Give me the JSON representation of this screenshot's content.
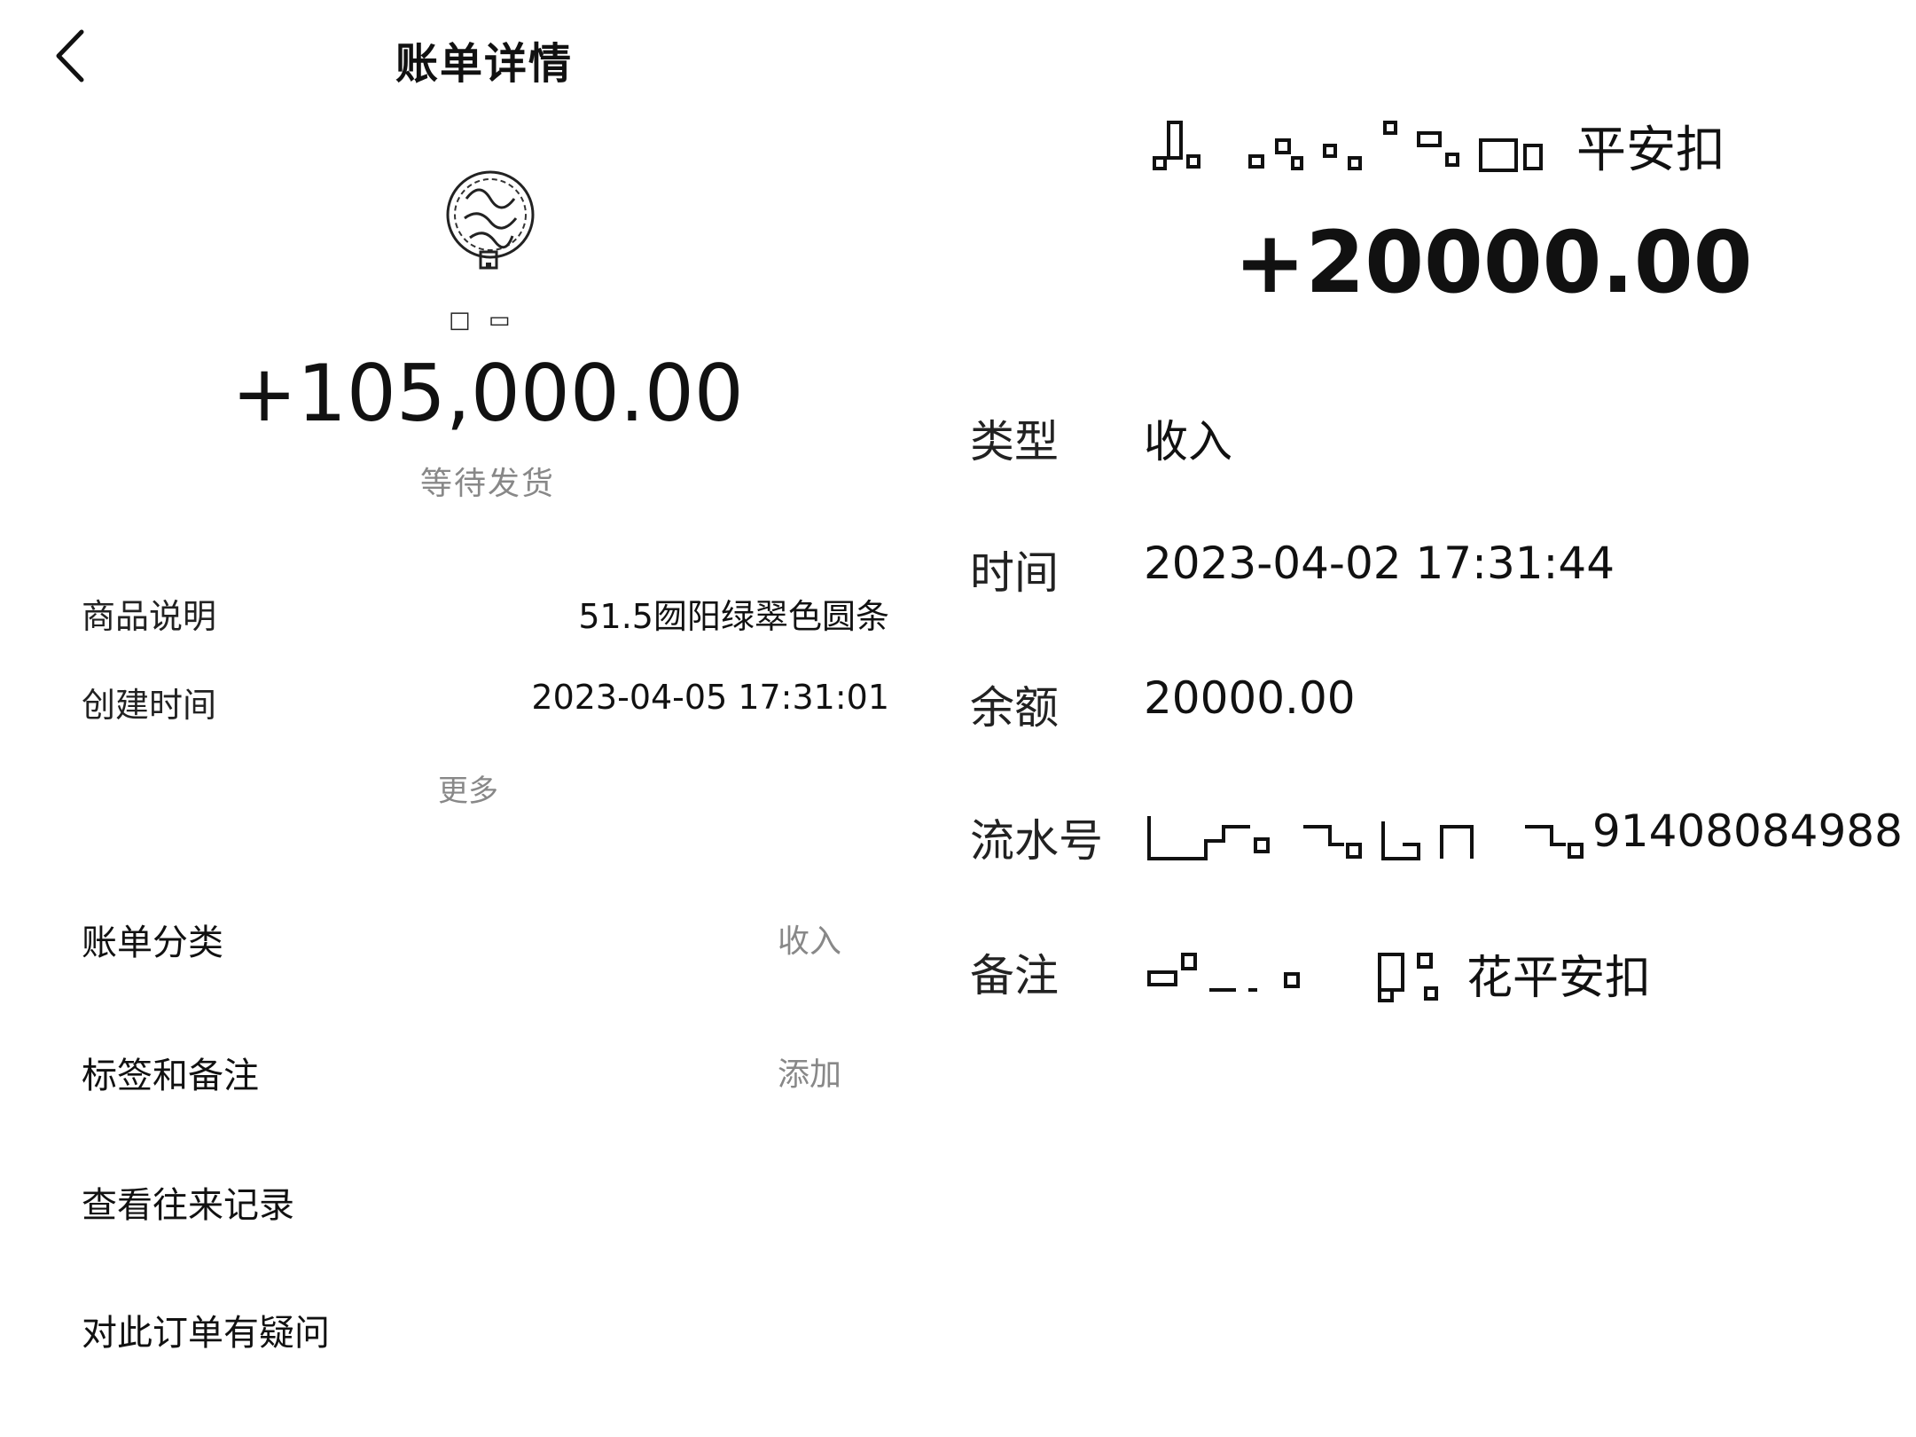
{
  "header": {
    "back_icon": "chevron-left-icon",
    "title": "账单详情"
  },
  "merchant": {
    "logo_icon": "merchant-logo",
    "name": "□ ▭"
  },
  "bill": {
    "amount": "+105,000.00",
    "status": "等待发货",
    "details": [
      {
        "label": "商品说明",
        "value": "51.5囫阳绿翠色圆条"
      },
      {
        "label": "创建时间",
        "value": "2023-04-05 17:31:01"
      }
    ],
    "more_label": "更多",
    "menu": [
      {
        "label": "账单分类",
        "value": "收入"
      },
      {
        "label": "标签和备注",
        "value": "添加"
      },
      {
        "label": "查看往来记录",
        "value": ""
      },
      {
        "label": "对此订单有疑问",
        "value": ""
      }
    ]
  },
  "second_receipt": {
    "title_tail": "平安扣",
    "amount": "+20000.00",
    "rows": [
      {
        "label": "类型",
        "value": "收入"
      },
      {
        "label": "时间",
        "value": "2023-04-02 17:31:44"
      },
      {
        "label": "余额",
        "value": "20000.00"
      },
      {
        "label": "流水号",
        "value": "91408084988"
      },
      {
        "label": "备注",
        "value": "花平安扣"
      }
    ]
  }
}
